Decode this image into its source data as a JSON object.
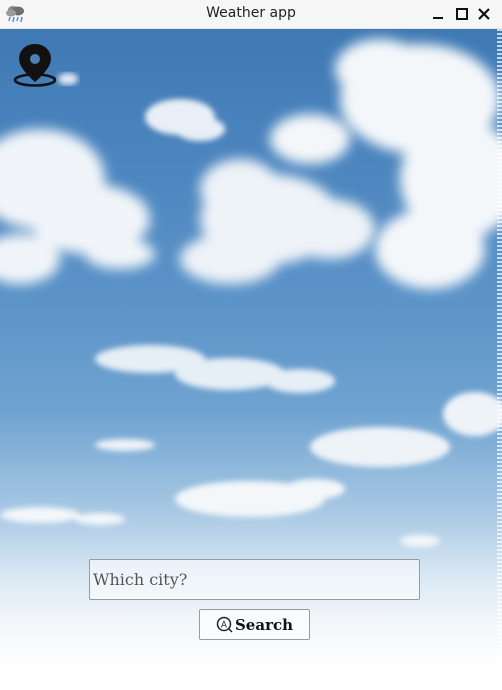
{
  "window": {
    "title": "Weather app",
    "app_icon": "weather-rain-cloud-icon",
    "controls": [
      "minimize-icon",
      "maximize-icon",
      "close-icon"
    ]
  },
  "location_button": {
    "icon": "map-pin-icon"
  },
  "search": {
    "placeholder": "Which city?",
    "value": "",
    "button_label": "Search",
    "button_icon": "search-icon"
  },
  "background": {
    "type": "sky-with-clouds",
    "colors": {
      "sky_top": "#3f79b4",
      "sky_bottom": "#ffffff"
    }
  }
}
